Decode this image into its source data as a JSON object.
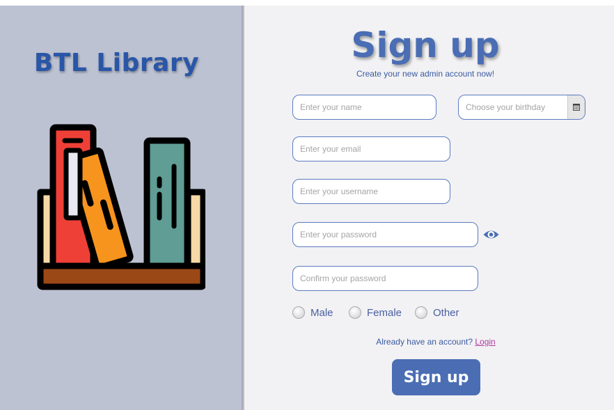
{
  "brand": {
    "title": "BTL Library"
  },
  "form": {
    "title": "Sign up",
    "subtitle": "Create your new admin account now!",
    "name_placeholder": "Enter your name",
    "birthday_placeholder": "Choose your birthday",
    "email_placeholder": "Enter your email",
    "username_placeholder": "Enter your username",
    "password_placeholder": "Enter your password",
    "confirm_placeholder": "Confirm your password",
    "gender_options": [
      "Male",
      "Female",
      "Other"
    ],
    "login_prompt": "Already have an account?",
    "login_link": "Login",
    "submit_label": "Sign up"
  },
  "icons": {
    "birthday_button": "calendar-icon",
    "password_toggle": "eye-icon",
    "logo": "books-on-shelf-icon"
  },
  "colors": {
    "accent": "#4a6db4",
    "brand_text": "#2a56a8",
    "left_panel": "#bcc2d2",
    "right_panel": "#f2f2f4",
    "link": "#b0389f"
  }
}
